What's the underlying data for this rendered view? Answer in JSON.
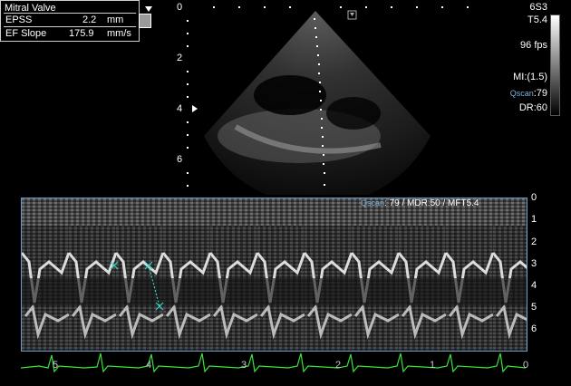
{
  "measurement": {
    "title": "Mitral Valve",
    "rows": [
      {
        "label": "EPSS",
        "value": "2.2",
        "unit": "mm"
      },
      {
        "label": "EF Slope",
        "value": "175.9",
        "unit": "mm/s"
      }
    ]
  },
  "depth_scale": [
    "0",
    "2",
    "4",
    "6"
  ],
  "right_panel": {
    "probe": "6S3",
    "frequency": "T5.4",
    "frame_rate": "96 fps",
    "mi": "MI:(1.5)",
    "qscan_logo": "Qscan",
    "qscan_value": ":79",
    "dr": "DR:60"
  },
  "mmode_header": {
    "qscan_logo": "Qscan",
    "text": ": 79    / MDR:50 / MFT5.4"
  },
  "mmode_depth_scale": [
    "0",
    "1",
    "2",
    "3",
    "4",
    "5",
    "6"
  ],
  "time_labels": [
    "5",
    "4",
    "3",
    "2",
    "1",
    "0"
  ],
  "colors": {
    "ecg": "#39e639",
    "caliper": "#3ad6c8",
    "border": "#6a9cc9"
  }
}
